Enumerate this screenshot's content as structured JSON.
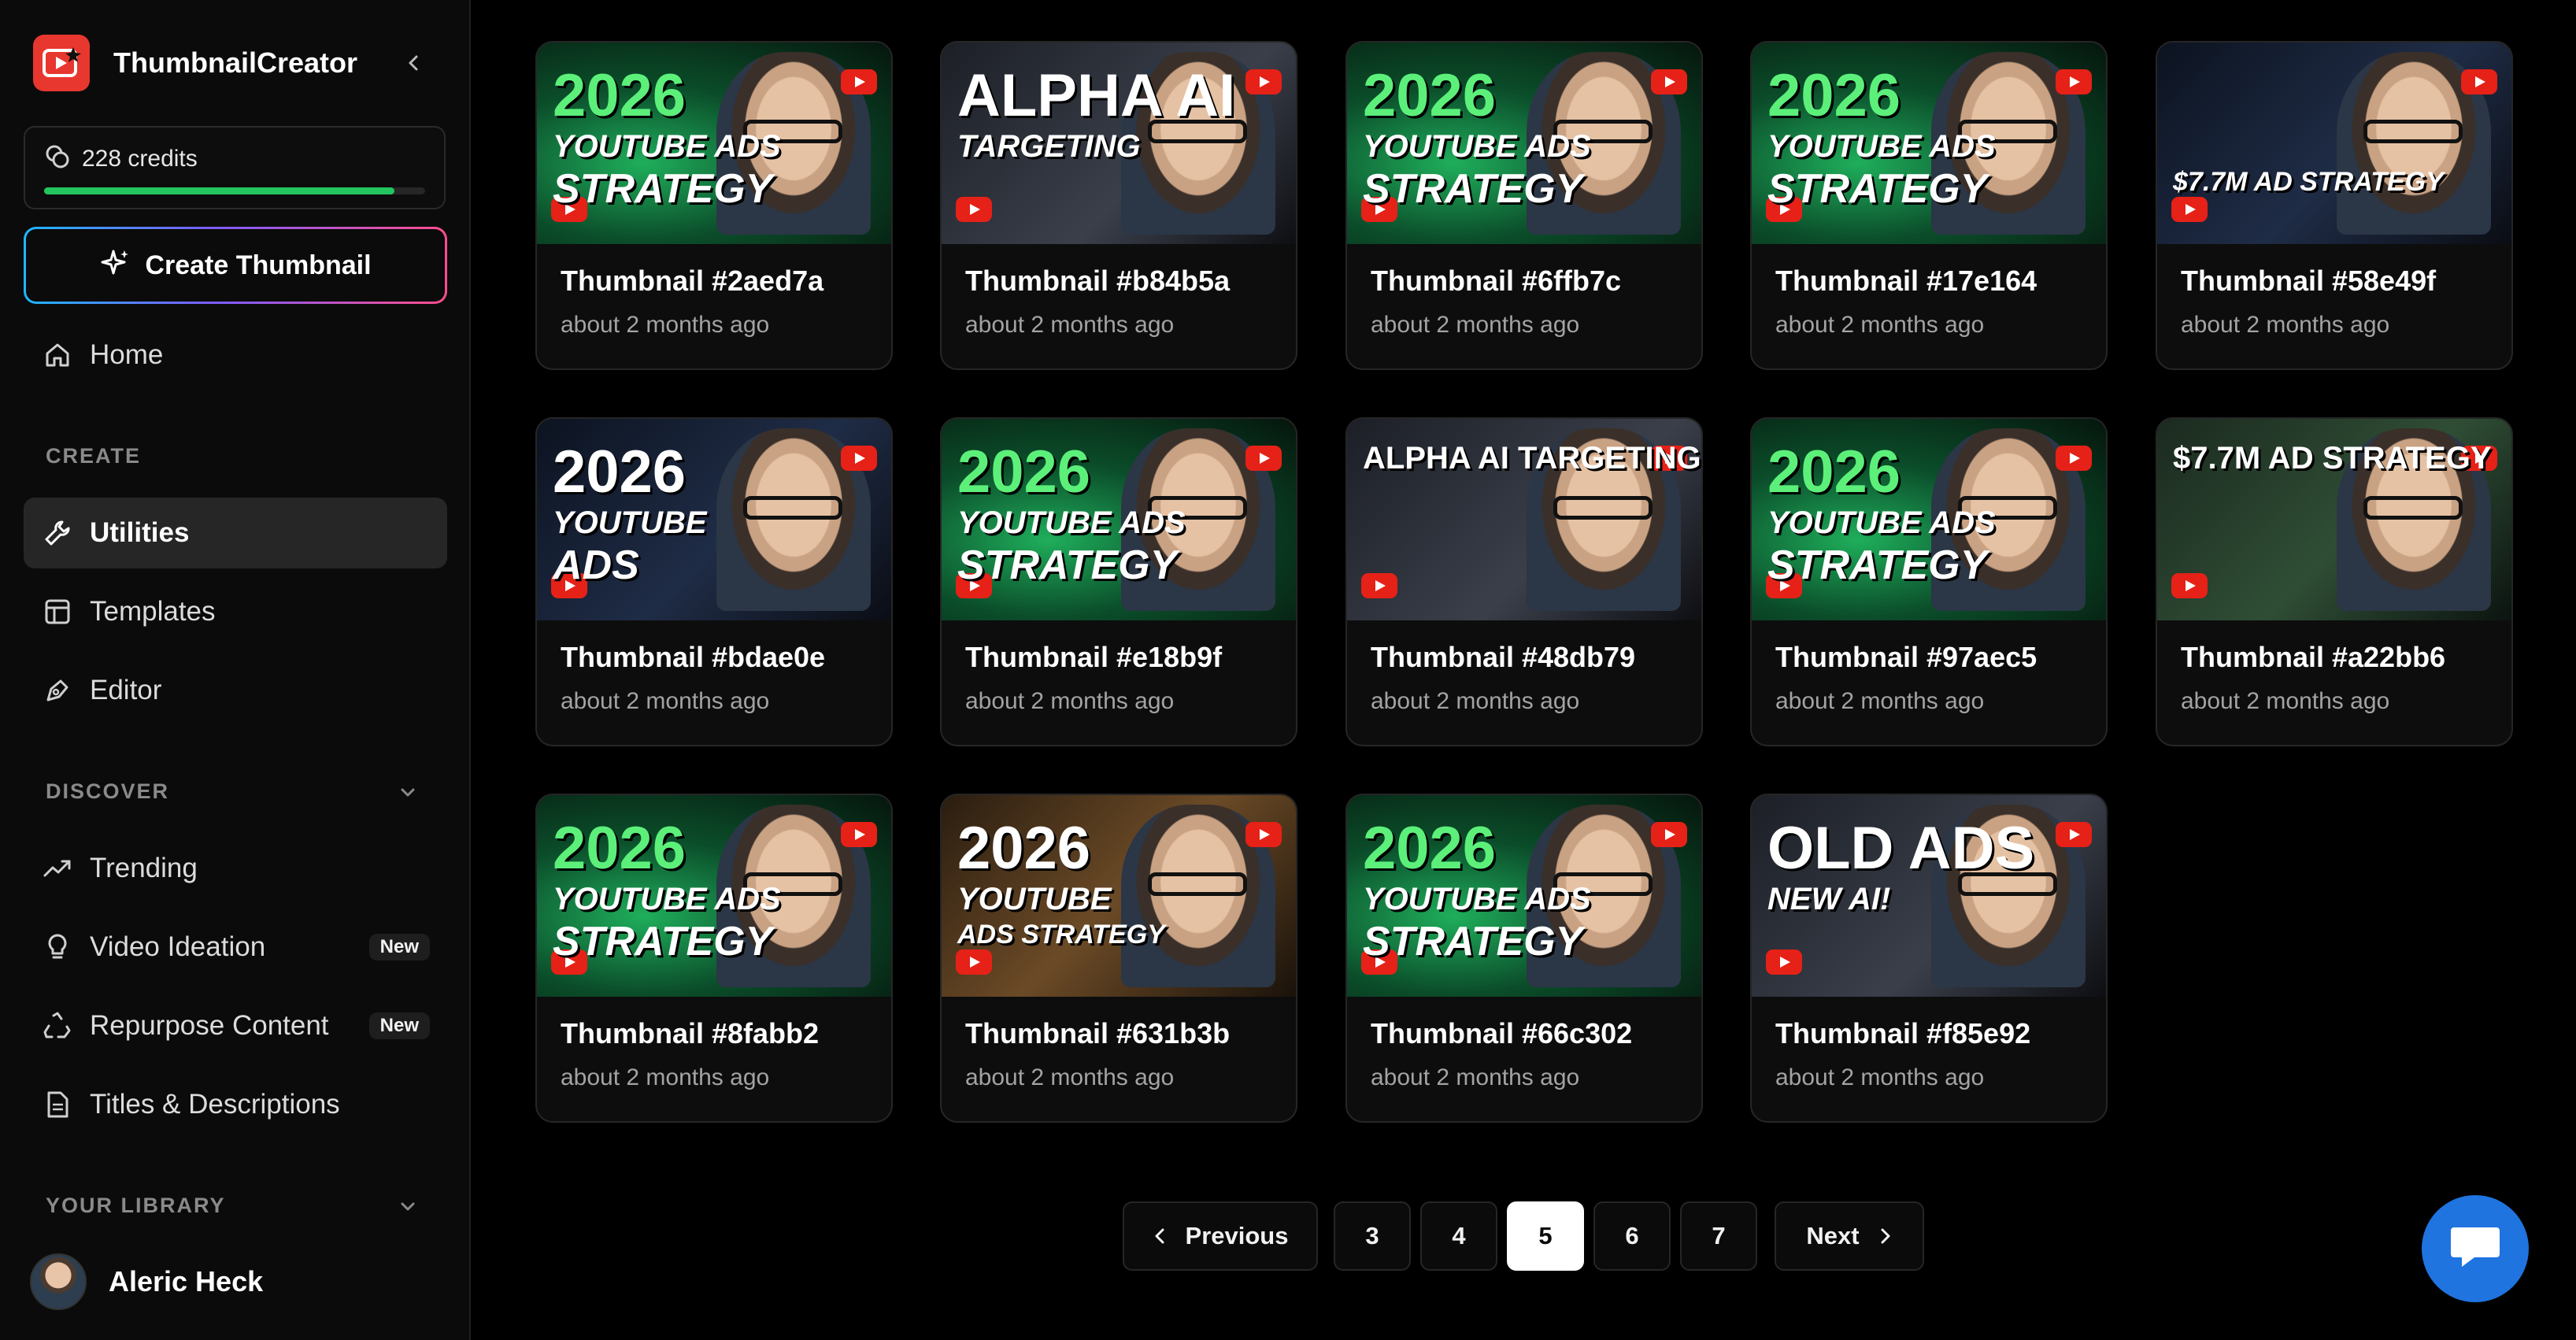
{
  "app": {
    "name": "ThumbnailCreator"
  },
  "credits": {
    "label": "228 credits",
    "fraction": 0.92
  },
  "sidebar": {
    "create_label": "Create Thumbnail",
    "home_label": "Home",
    "create_section": "CREATE",
    "create_items": [
      {
        "label": "Utilities",
        "icon": "wrench-icon",
        "active": true
      },
      {
        "label": "Templates",
        "icon": "layout-icon",
        "active": false
      },
      {
        "label": "Editor",
        "icon": "pen-tool-icon",
        "active": false
      }
    ],
    "discover_section": "DISCOVER",
    "discover_items": [
      {
        "label": "Trending",
        "icon": "trending-up-icon",
        "badge": ""
      },
      {
        "label": "Video Ideation",
        "icon": "lightbulb-icon",
        "badge": "New"
      },
      {
        "label": "Repurpose Content",
        "icon": "recycle-icon",
        "badge": "New"
      },
      {
        "label": "Titles & Descriptions",
        "icon": "file-text-icon",
        "badge": ""
      }
    ],
    "library_section": "YOUR LIBRARY",
    "user_name": "Aleric Heck"
  },
  "thumbnails": [
    {
      "title": "Thumbnail #2aed7a",
      "time": "about 2 months ago",
      "style": "green",
      "line1": "2026",
      "line2": "YOUTUBE ADS",
      "line3": "STRATEGY"
    },
    {
      "title": "Thumbnail #b84b5a",
      "time": "about 2 months ago",
      "style": "dark",
      "line1": "ALPHA AI",
      "line2": "TARGETING",
      "line3": ""
    },
    {
      "title": "Thumbnail #6ffb7c",
      "time": "about 2 months ago",
      "style": "green",
      "line1": "2026",
      "line2": "YOUTUBE ADS",
      "line3": "STRATEGY"
    },
    {
      "title": "Thumbnail #17e164",
      "time": "about 2 months ago",
      "style": "green",
      "line1": "2026",
      "line2": "YOUTUBE ADS",
      "line3": "STRATEGY"
    },
    {
      "title": "Thumbnail #58e49f",
      "time": "about 2 months ago",
      "style": "blue",
      "line1": "",
      "line2": "",
      "line3": "$7.7M AD STRATEGY"
    },
    {
      "title": "Thumbnail #bdae0e",
      "time": "about 2 months ago",
      "style": "blue",
      "line1": "2026",
      "line2": "YOUTUBE",
      "line3": "ADS"
    },
    {
      "title": "Thumbnail #e18b9f",
      "time": "about 2 months ago",
      "style": "green",
      "line1": "2026",
      "line2": "YOUTUBE ADS",
      "line3": "STRATEGY"
    },
    {
      "title": "Thumbnail #48db79",
      "time": "about 2 months ago",
      "style": "dark",
      "line1": "ALPHA AI TARGETING",
      "line2": "",
      "line3": ""
    },
    {
      "title": "Thumbnail #97aec5",
      "time": "about 2 months ago",
      "style": "green",
      "line1": "2026",
      "line2": "YOUTUBE ADS",
      "line3": "STRATEGY"
    },
    {
      "title": "Thumbnail #a22bb6",
      "time": "about 2 months ago",
      "style": "lab",
      "line1": "$7.7M AD STRATEGY",
      "line2": "",
      "line3": ""
    },
    {
      "title": "Thumbnail #8fabb2",
      "time": "about 2 months ago",
      "style": "green",
      "line1": "2026",
      "line2": "YOUTUBE ADS",
      "line3": "STRATEGY"
    },
    {
      "title": "Thumbnail #631b3b",
      "time": "about 2 months ago",
      "style": "warm",
      "line1": "2026",
      "line2": "YOUTUBE",
      "line3": "ADS STRATEGY"
    },
    {
      "title": "Thumbnail #66c302",
      "time": "about 2 months ago",
      "style": "green",
      "line1": "2026",
      "line2": "YOUTUBE ADS",
      "line3": "STRATEGY"
    },
    {
      "title": "Thumbnail #f85e92",
      "time": "about 2 months ago",
      "style": "dark",
      "line1": "OLD ADS",
      "line2": "NEW AI!",
      "line3": ""
    }
  ],
  "pagination": {
    "previous_label": "Previous",
    "next_label": "Next",
    "pages": [
      "3",
      "4",
      "5",
      "6",
      "7"
    ],
    "current": "5"
  },
  "colors": {
    "accent": "#22c55e",
    "brand": "#e8372f",
    "chat": "#1f74e0"
  }
}
